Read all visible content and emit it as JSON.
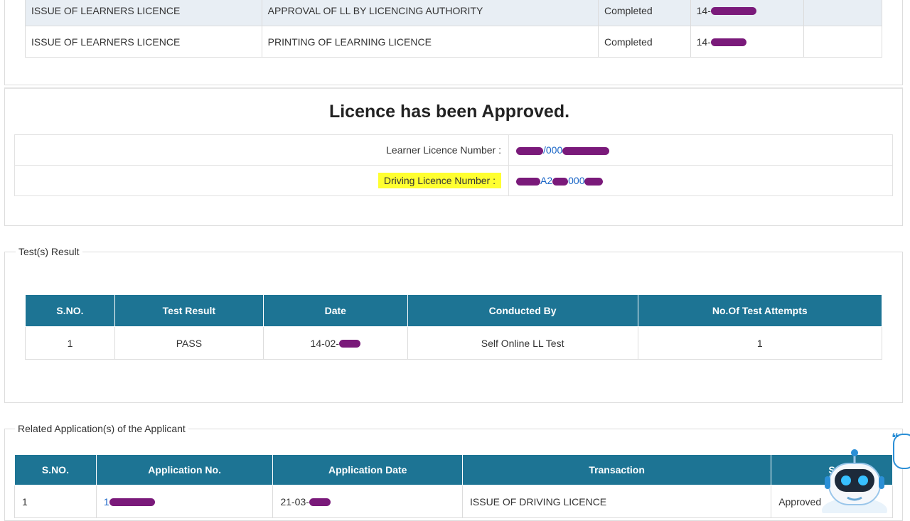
{
  "status_rows": [
    {
      "service": "ISSUE OF LEARNERS LICENCE",
      "task": "APPROVAL OF LL BY LICENCING AUTHORITY",
      "status": "Completed",
      "date_prefix": "14-"
    },
    {
      "service": "ISSUE OF LEARNERS LICENCE",
      "task": "PRINTING OF LEARNING LICENCE",
      "status": "Completed",
      "date_prefix": "14-"
    }
  ],
  "approval": {
    "title": "Licence has been Approved.",
    "learner_label": "Learner Licence Number :",
    "learner_value_visible": "/000",
    "driving_label": "Driving Licence Number :",
    "driving_value_visible": "A2",
    "driving_value_visible2": "000"
  },
  "tests": {
    "legend": "Test(s) Result",
    "headers": [
      "S.NO.",
      "Test Result",
      "Date",
      "Conducted By",
      "No.Of Test Attempts"
    ],
    "rows": [
      {
        "sno": "1",
        "result": "PASS",
        "date_prefix": "14-02-",
        "conducted_by": "Self Online LL Test",
        "attempts": "1"
      }
    ]
  },
  "related": {
    "legend": "Related Application(s) of the Applicant",
    "headers": [
      "S.NO.",
      "Application No.",
      "Application Date",
      "Transaction",
      "S"
    ],
    "rows": [
      {
        "sno": "1",
        "app_no_prefix": "1",
        "app_date_prefix": "21-03-",
        "transaction": "ISSUE OF DRIVING LICENCE",
        "status": "Approved"
      }
    ]
  },
  "chatbot": {
    "icon": "chatbot-robot-icon",
    "bubble_glyph": "❝"
  },
  "colors": {
    "header_bg": "#1d7494",
    "highlight": "#ffff30",
    "link": "#1a66c7",
    "redaction": "#7a1a7a"
  }
}
